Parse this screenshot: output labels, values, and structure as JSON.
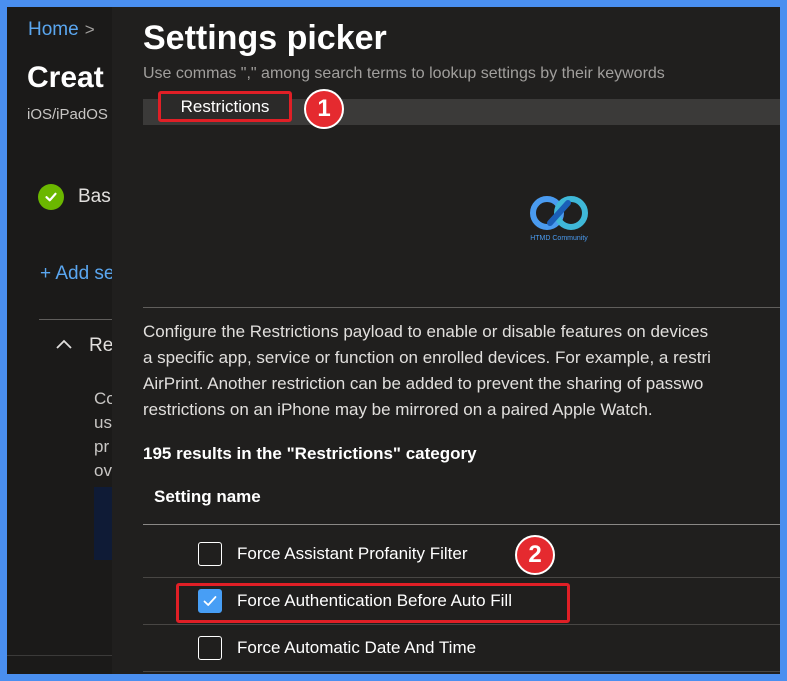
{
  "background_page": {
    "breadcrumb_home": "Home",
    "breadcrumb_separator": ">",
    "title": "Creat",
    "subtitle": "iOS/iPadOS",
    "step_label": "Bas",
    "add_settings_link": "+ Add se",
    "section_label": "Re",
    "description_lines": [
      "Co",
      "us",
      "pr",
      "ov"
    ]
  },
  "panel": {
    "title": "Settings picker",
    "hint": "Use commas \",\" among search terms to lookup settings by their keywords",
    "search_value": "Restrictions",
    "logo_caption": "HTMD Community",
    "description_lines": [
      "Configure the Restrictions payload to enable or disable features on devices",
      "a specific app, service or function on enrolled devices. For example, a restri",
      "AirPrint. Another restriction can be added to prevent the sharing of passwo",
      "restrictions on an iPhone may be mirrored on a paired Apple Watch."
    ],
    "results_count": "195 results in the \"Restrictions\" category",
    "column_header": "Setting name",
    "settings": [
      {
        "label": "Force Assistant Profanity Filter",
        "checked": false
      },
      {
        "label": "Force Authentication Before Auto Fill",
        "checked": true
      },
      {
        "label": "Force Automatic Date And Time",
        "checked": false
      }
    ]
  },
  "annotations": {
    "callout_1": "1",
    "callout_2": "2"
  },
  "colors": {
    "accent_blue": "#479ef5",
    "callout_red": "#e52a2f",
    "success_green": "#6bb700",
    "frame_blue": "#4a8ff0"
  },
  "icons": [
    "chevron-right-icon",
    "check-circle-icon",
    "chevron-up-icon",
    "checkbox-checked-icon",
    "htmd-logo-icon"
  ]
}
